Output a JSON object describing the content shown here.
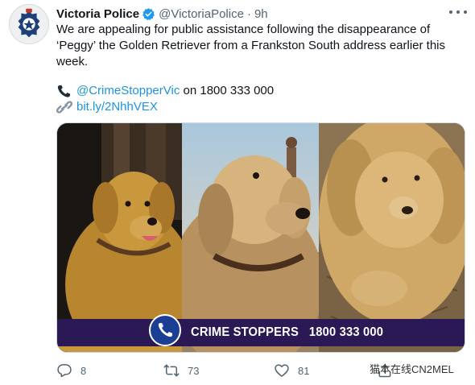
{
  "author": {
    "display_name": "Victoria Police",
    "handle": "@VictoriaPolice",
    "separator": "·",
    "time": "9h",
    "avatar_icon": "victoria-police-badge"
  },
  "tweet": {
    "text": "We are appealing for public assistance following the disappearance of ‘Peggy’ the Golden Retriever from a Frankston South address earlier this week.",
    "phone_mention": "@CrimeStopperVic",
    "phone_text": " on 1800 333 000",
    "link": "bit.ly/2NhhVEX",
    "phone_icon": "telephone-receiver-icon",
    "link_icon": "link-icon"
  },
  "media": {
    "banner_label": "CRIME STOPPERS",
    "banner_number": "1800 333 000",
    "banner_icon": "phone-icon",
    "banner_color": "#2a1955"
  },
  "actions": {
    "replies": "8",
    "retweets": "73",
    "likes": "81"
  },
  "watermark": {
    "text": "猫本在线CN2MEL"
  },
  "colors": {
    "link": "#1b95e0",
    "muted": "#536471",
    "verified": "#1d9bf0"
  }
}
